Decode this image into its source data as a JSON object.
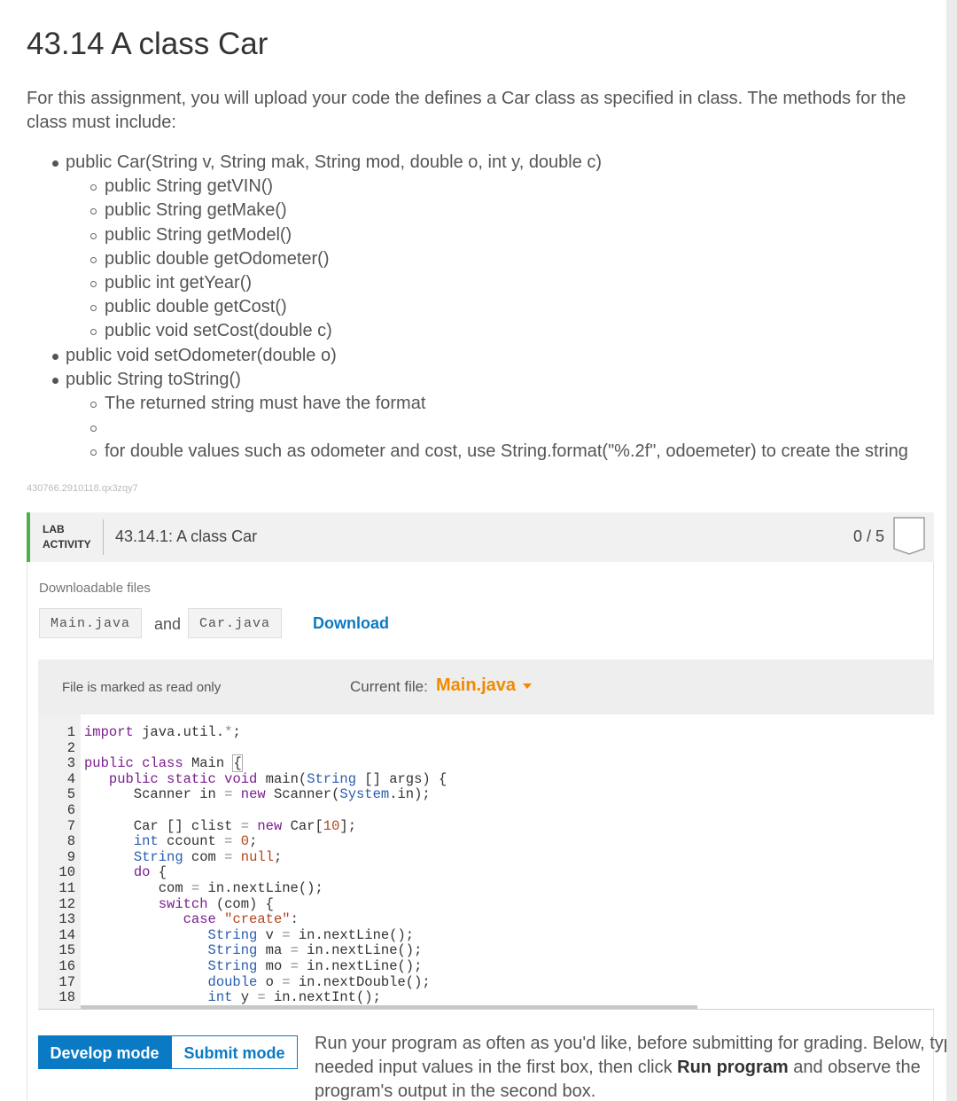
{
  "section_title": "43.14 A class Car",
  "intro": "For this assignment, you will upload your code the defines a Car class as specified in class. The methods for the class must include:",
  "methods": [
    {
      "level": 1,
      "text": "public Car(String v, String mak, String mod, double o, int y, double c)"
    },
    {
      "level": 2,
      "text": "public String getVIN()"
    },
    {
      "level": 2,
      "text": "public String getMake()"
    },
    {
      "level": 2,
      "text": "public String getModel()"
    },
    {
      "level": 2,
      "text": "public double getOdometer()"
    },
    {
      "level": 2,
      "text": "public int getYear()"
    },
    {
      "level": 2,
      "text": "public double getCost()"
    },
    {
      "level": 2,
      "text": "public void setCost(double c)"
    },
    {
      "level": 1,
      "text": "public void setOdometer(double o)"
    },
    {
      "level": 1,
      "text": "public String toString()"
    },
    {
      "level": 2,
      "text": "The returned string must have the format"
    },
    {
      "level": 2,
      "text": ""
    },
    {
      "level": 2,
      "text": "for double values such as odometer and cost, use String.format(\"%.2f\", odoemeter) to create the string"
    }
  ],
  "item_id": "430766.2910118.qx3zqy7",
  "lab": {
    "tag_line1": "LAB",
    "tag_line2": "ACTIVITY",
    "title": "43.14.1: A class Car",
    "score": "0 / 5",
    "downloadable_label": "Downloadable files",
    "file1": "Main.java",
    "and": "and",
    "file2": "Car.java",
    "download": "Download",
    "readonly": "File is marked as read only",
    "current_file_label": "Current file:",
    "current_file": "Main.java",
    "line_numbers": [
      "1",
      "2",
      "3",
      "4",
      "5",
      "6",
      "7",
      "8",
      "9",
      "10",
      "11",
      "12",
      "13",
      "14",
      "15",
      "16",
      "17",
      "18"
    ],
    "develop_mode": "Develop mode",
    "submit_mode": "Submit mode",
    "run_text_1": "Run your program as often as you'd like, before submitting for grading. Below, type needed input values in the first box, then click ",
    "run_text_bold": "Run program",
    "run_text_2": " and observe the program's output in the second box."
  },
  "colors": {
    "accent_blue": "#0a7ac4",
    "lab_green": "#4caf50",
    "current_file_orange": "#f08a00"
  }
}
